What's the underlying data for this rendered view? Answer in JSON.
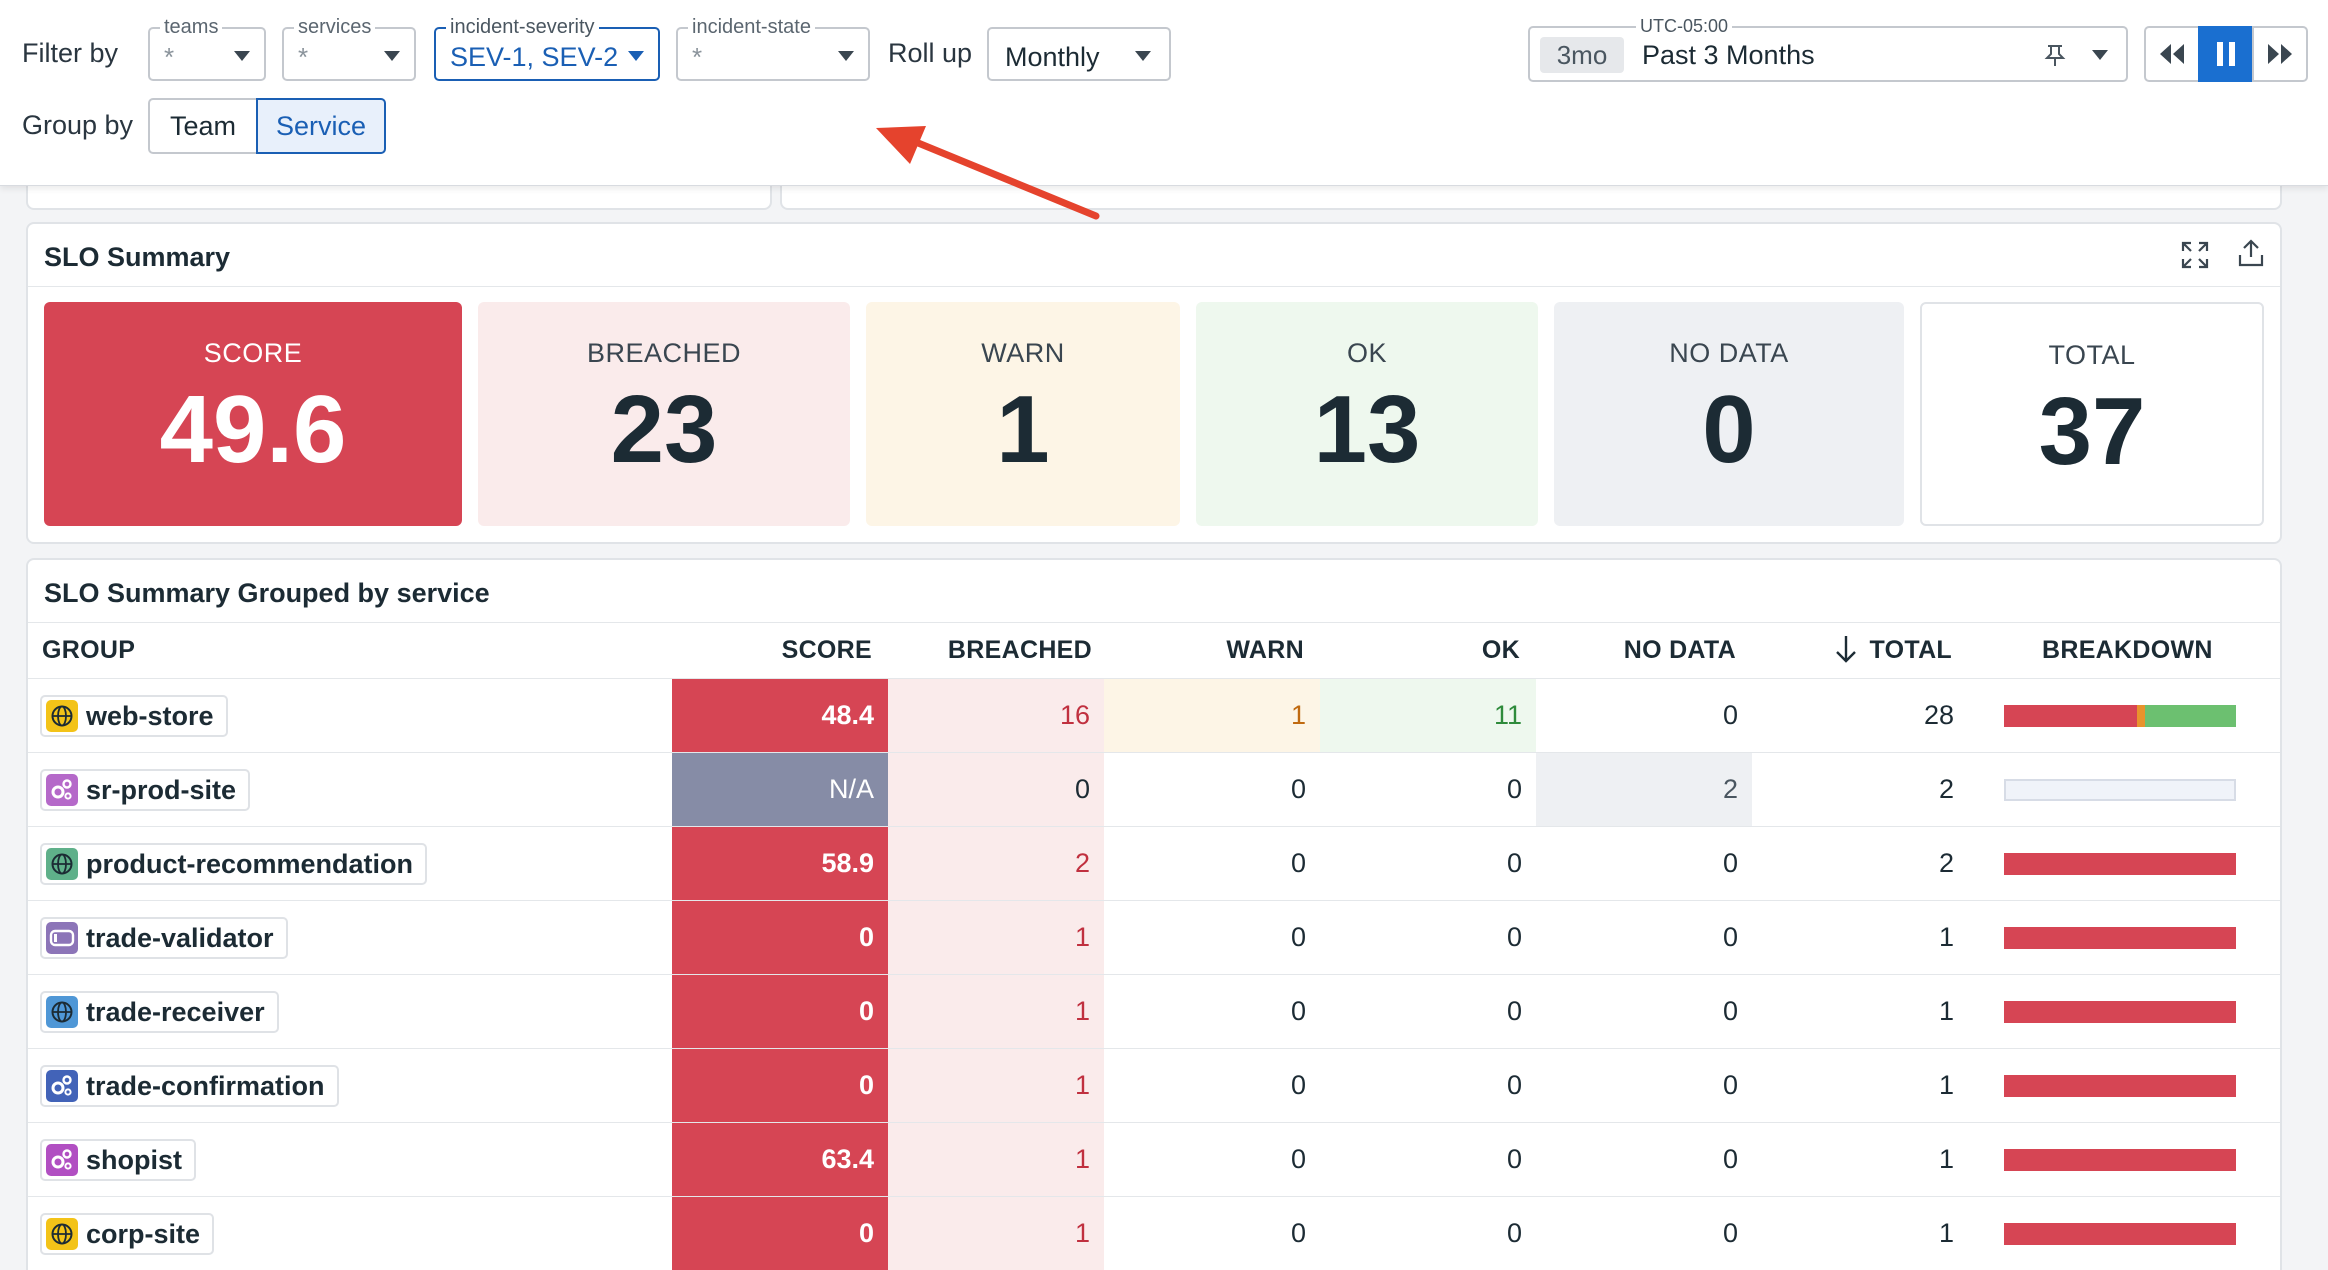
{
  "filters": {
    "filter_by_label": "Filter by",
    "group_by_label": "Group by",
    "roll_up_label": "Roll up",
    "selects": [
      {
        "legend": "teams",
        "value": "*"
      },
      {
        "legend": "services",
        "value": "*"
      },
      {
        "legend": "incident-severity",
        "value": "SEV-1, SEV-2"
      },
      {
        "legend": "incident-state",
        "value": "*"
      }
    ],
    "rollup_value": "Monthly",
    "group_options": [
      "Team",
      "Service"
    ],
    "group_selected": "Service"
  },
  "timeframe": {
    "timezone": "UTC-05:00",
    "chip": "3mo",
    "label": "Past 3 Months"
  },
  "summary": {
    "title": "SLO Summary",
    "cards": [
      {
        "label": "SCORE",
        "value": "49.6"
      },
      {
        "label": "BREACHED",
        "value": "23"
      },
      {
        "label": "WARN",
        "value": "1"
      },
      {
        "label": "OK",
        "value": "13"
      },
      {
        "label": "NO DATA",
        "value": "0"
      },
      {
        "label": "TOTAL",
        "value": "37"
      }
    ]
  },
  "grouped": {
    "title": "SLO Summary Grouped by service",
    "columns": [
      "GROUP",
      "SCORE",
      "BREACHED",
      "WARN",
      "OK",
      "NO DATA",
      "TOTAL",
      "BREAKDOWN"
    ],
    "sort_column": "TOTAL",
    "rows": [
      {
        "name": "web-store",
        "icon": "globe-icon",
        "score": "48.4",
        "breached": "16",
        "warn": "1",
        "ok": "11",
        "nodata": "0",
        "total": "28"
      },
      {
        "name": "sr-prod-site",
        "icon": "gears-icon",
        "score": "N/A",
        "breached": "0",
        "warn": "0",
        "ok": "0",
        "nodata": "2",
        "total": "2"
      },
      {
        "name": "product-recommendation",
        "icon": "globe-icon",
        "score": "58.9",
        "breached": "2",
        "warn": "0",
        "ok": "0",
        "nodata": "0",
        "total": "2"
      },
      {
        "name": "trade-validator",
        "icon": "toggle-icon",
        "score": "0",
        "breached": "1",
        "warn": "0",
        "ok": "0",
        "nodata": "0",
        "total": "1"
      },
      {
        "name": "trade-receiver",
        "icon": "globe-icon",
        "score": "0",
        "breached": "1",
        "warn": "0",
        "ok": "0",
        "nodata": "0",
        "total": "1"
      },
      {
        "name": "trade-confirmation",
        "icon": "gears-icon",
        "score": "0",
        "breached": "1",
        "warn": "0",
        "ok": "0",
        "nodata": "0",
        "total": "1"
      },
      {
        "name": "shopist",
        "icon": "gears-icon",
        "score": "63.4",
        "breached": "1",
        "warn": "0",
        "ok": "0",
        "nodata": "0",
        "total": "1"
      },
      {
        "name": "corp-site",
        "icon": "globe-icon",
        "score": "0",
        "breached": "1",
        "warn": "0",
        "ok": "0",
        "nodata": "0",
        "total": "1"
      }
    ]
  },
  "colors": {
    "accent": "#1a5fb4",
    "breached": "#d64554",
    "warn": "#e8932c",
    "ok": "#6cc070",
    "nodata_bar": "#f0f3f9"
  }
}
